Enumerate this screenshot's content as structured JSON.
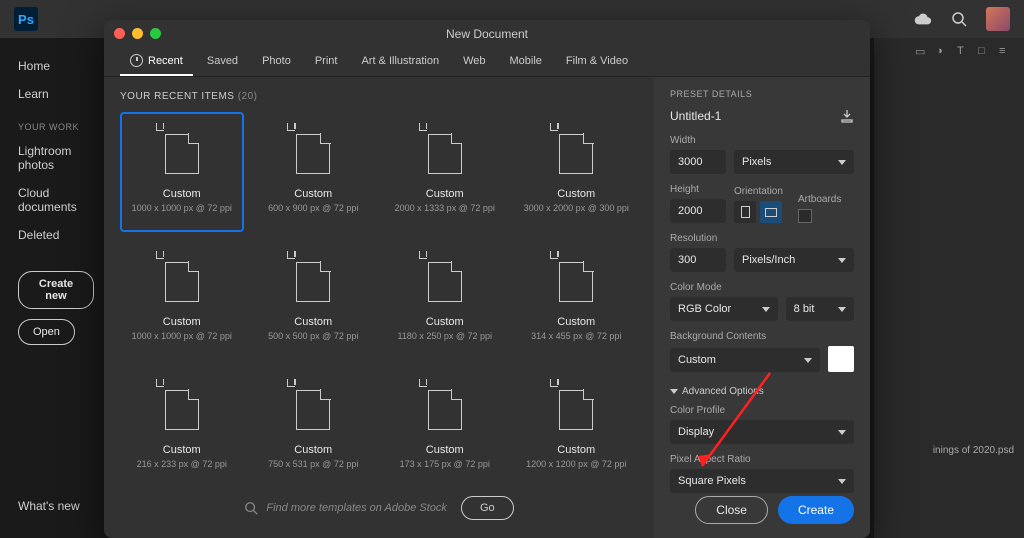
{
  "app": {
    "logo_text": "Ps"
  },
  "topbar_icons": [
    "cloud-icon",
    "search-icon"
  ],
  "left_panel": {
    "home": "Home",
    "learn": "Learn",
    "work_heading": "YOUR WORK",
    "items": [
      "Lightroom photos",
      "Cloud documents",
      "Deleted"
    ],
    "create_new": "Create new",
    "open": "Open",
    "whats_new": "What's new"
  },
  "dialog": {
    "title": "New Document",
    "tabs": [
      "Recent",
      "Saved",
      "Photo",
      "Print",
      "Art & Illustration",
      "Web",
      "Mobile",
      "Film & Video"
    ],
    "recent_header": "YOUR RECENT ITEMS",
    "recent_count": "(20)",
    "search_placeholder": "Find more templates on Adobe Stock",
    "go": "Go",
    "close": "Close",
    "create": "Create"
  },
  "presets": [
    {
      "name": "Custom",
      "dim": "1000 x 1000 px @ 72 ppi"
    },
    {
      "name": "Custom",
      "dim": "600 x 900 px @ 72 ppi"
    },
    {
      "name": "Custom",
      "dim": "2000 x 1333 px @ 72 ppi"
    },
    {
      "name": "Custom",
      "dim": "3000 x 2000 px @ 300 ppi"
    },
    {
      "name": "Custom",
      "dim": "1000 x 1000 px @ 72 ppi"
    },
    {
      "name": "Custom",
      "dim": "500 x 500 px @ 72 ppi"
    },
    {
      "name": "Custom",
      "dim": "1180 x 250 px @ 72 ppi"
    },
    {
      "name": "Custom",
      "dim": "314 x 455 px @ 72 ppi"
    },
    {
      "name": "Custom",
      "dim": "216 x 233 px @ 72 ppi"
    },
    {
      "name": "Custom",
      "dim": "750 x 531 px @ 72 ppi"
    },
    {
      "name": "Custom",
      "dim": "173 x 175 px @ 72 ppi"
    },
    {
      "name": "Custom",
      "dim": "1200 x 1200 px @ 72 ppi"
    }
  ],
  "details": {
    "header": "PRESET DETAILS",
    "name": "Untitled-1",
    "width_label": "Width",
    "width": "3000",
    "unit": "Pixels",
    "height_label": "Height",
    "height": "2000",
    "orientation_label": "Orientation",
    "artboards_label": "Artboards",
    "resolution_label": "Resolution",
    "resolution": "300",
    "res_unit": "Pixels/Inch",
    "color_mode_label": "Color Mode",
    "color_mode": "RGB Color",
    "bit_depth": "8 bit",
    "bg_label": "Background Contents",
    "bg": "Custom",
    "adv": "Advanced Options",
    "color_profile_label": "Color Profile",
    "color_profile": "Display",
    "par_label": "Pixel Aspect Ratio",
    "par": "Square Pixels"
  },
  "bg_file": "inings of 2020.psd"
}
